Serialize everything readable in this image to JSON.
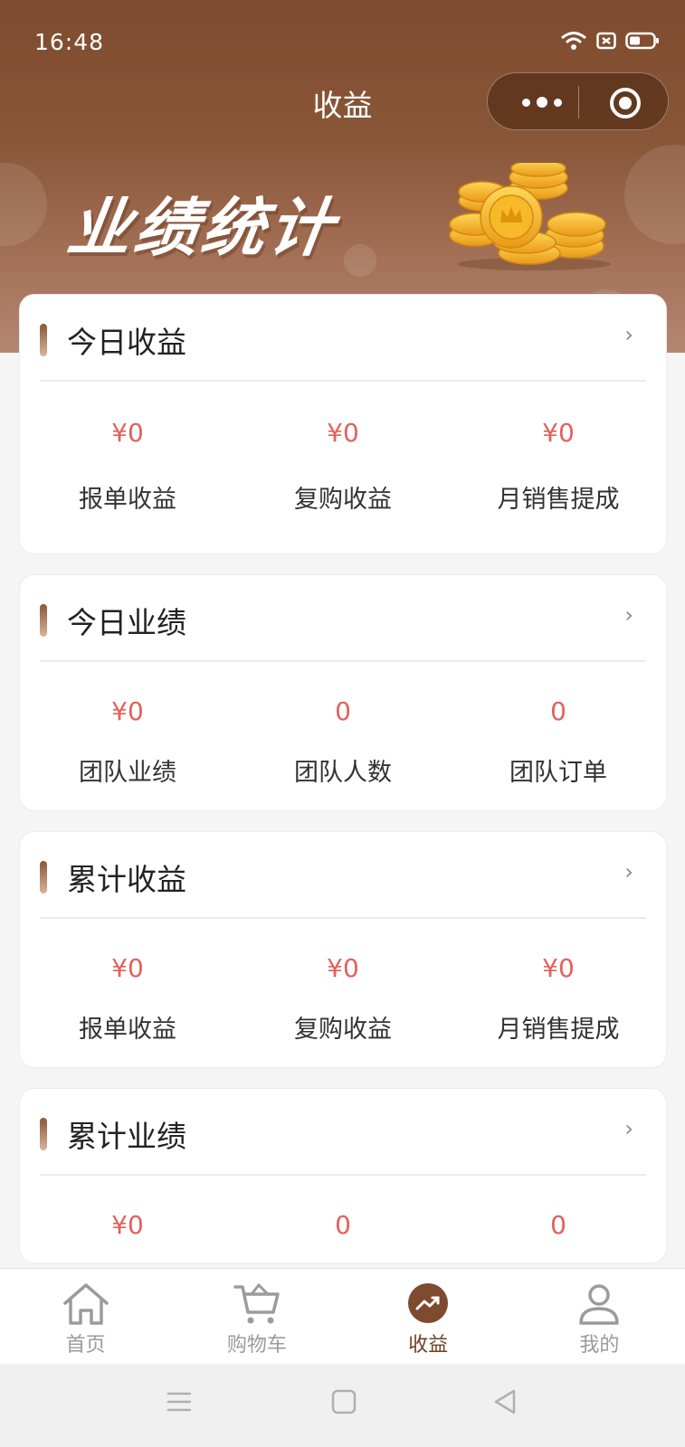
{
  "status_bar": {
    "time": "16:48"
  },
  "nav": {
    "title": "收益"
  },
  "banner": {
    "title": "业绩统计"
  },
  "cards": [
    {
      "title": "今日收益",
      "stats": [
        {
          "value": "¥0",
          "label": "报单收益"
        },
        {
          "value": "¥0",
          "label": "复购收益"
        },
        {
          "value": "¥0",
          "label": "月销售提成"
        }
      ]
    },
    {
      "title": "今日业绩",
      "stats": [
        {
          "value": "¥0",
          "label": "团队业绩"
        },
        {
          "value": "0",
          "label": "团队人数"
        },
        {
          "value": "0",
          "label": "团队订单"
        }
      ]
    },
    {
      "title": "累计收益",
      "stats": [
        {
          "value": "¥0",
          "label": "报单收益"
        },
        {
          "value": "¥0",
          "label": "复购收益"
        },
        {
          "value": "¥0",
          "label": "月销售提成"
        }
      ]
    },
    {
      "title": "累计业绩",
      "stats": [
        {
          "value": "¥0"
        },
        {
          "value": "0"
        },
        {
          "value": "0"
        }
      ]
    }
  ],
  "tabbar": {
    "items": [
      {
        "label": "首页",
        "icon": "home-icon",
        "active": false
      },
      {
        "label": "购物车",
        "icon": "cart-icon",
        "active": false
      },
      {
        "label": "收益",
        "icon": "trend-icon",
        "active": true
      },
      {
        "label": "我的",
        "icon": "user-icon",
        "active": false
      }
    ]
  },
  "colors": {
    "brand": "#7e4b2e",
    "value_red": "#e2615c",
    "active_tab": "#6e4028"
  }
}
